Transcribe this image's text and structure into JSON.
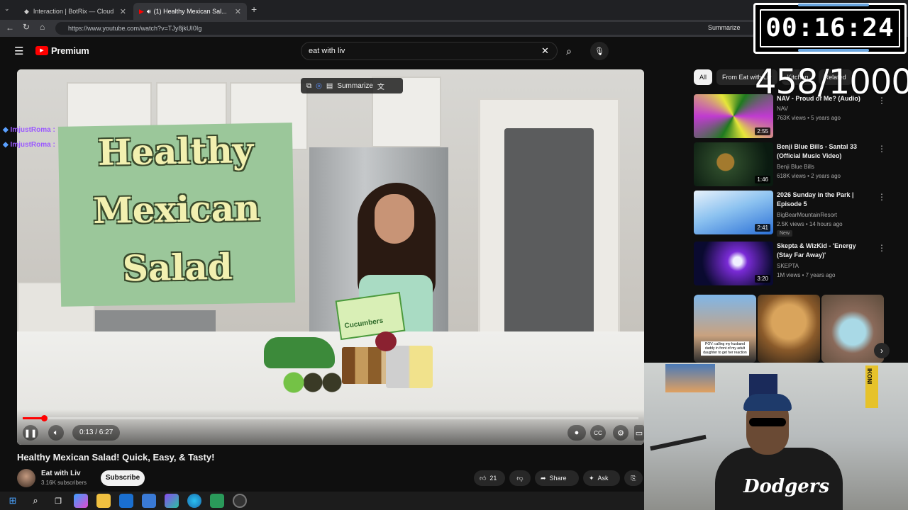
{
  "browser": {
    "tabs": [
      {
        "label": "Interaction | BotRix — Cloud",
        "active": false
      },
      {
        "label": "(1) Healthy Mexican Sal...",
        "active": true
      }
    ],
    "url": "https://www.youtube.com/watch?v=TJy8jkUI0Ig",
    "summarize_label": "Summarize"
  },
  "header": {
    "logo_text": "Premium",
    "search_value": "eat with liv"
  },
  "video": {
    "title_card_lines": [
      "Healthy",
      "Mexican",
      "Salad"
    ],
    "overlay_summarize": "Summarize",
    "current_time": "0:13 / 6:27",
    "progress_fraction": 0.034,
    "chat": [
      {
        "user": "ImjustRoma :",
        "msg": ""
      },
      {
        "user": "ImjustRoma :",
        "msg": ""
      }
    ],
    "product_label": "Cucumbers"
  },
  "below": {
    "title": "Healthy Mexican Salad! Quick, Easy, & Tasty!",
    "channel": "Eat with Liv",
    "subscribers": "3.16K subscribers",
    "subscribe": "Subscribe",
    "likes": "21",
    "share": "Share",
    "ask": "Ask"
  },
  "sidebar": {
    "chips": [
      "All",
      "From Eat with Liv",
      "Kitchen",
      "Related"
    ],
    "recommendations": [
      {
        "title": "NAV - Proud of Me? (Audio)",
        "channel": "NAV",
        "meta": "763K views • 5 years ago",
        "duration": "2:55",
        "colors": [
          "#1f7a1f",
          "#c03bd0",
          "#e6e63a"
        ]
      },
      {
        "title": "Benji Blue Bills - Santal 33 (Official Music Video)",
        "channel": "Benji Blue Bills",
        "meta": "618K views • 2 years ago",
        "duration": "1:46",
        "colors": [
          "#0a1a10",
          "#2d4a2a",
          "#a37a2e"
        ]
      },
      {
        "title": "2026 Sunday in the Park | Episode 5",
        "channel": "BigBearMountainResort",
        "meta": "2.5K views • 14 hours ago",
        "duration": "2:41",
        "colors": [
          "#2a6fd6",
          "#8cc2f0",
          "#e8f2fb"
        ],
        "badge": "New"
      },
      {
        "title": "Skepta & WizKid - 'Energy (Stay Far Away)'",
        "channel": "SKEPTA",
        "meta": "1M views • 7 years ago",
        "duration": "3:20",
        "colors": [
          "#0a0a30",
          "#7a2bd6",
          "#f0f0ff"
        ]
      }
    ],
    "shorts_caption": "POV: calling my husband daddy in front of my adult daughter to get her reaction"
  },
  "overlays": {
    "timer": "00:16:24",
    "counter": "458/1000",
    "webcam_sign": "IKONI",
    "jersey_text": "Dodgers"
  },
  "colors": {
    "yt_red": "#ff0000",
    "bg": "#0f0f0f",
    "chip": "#272727",
    "chat_user": "#9b59ff"
  }
}
